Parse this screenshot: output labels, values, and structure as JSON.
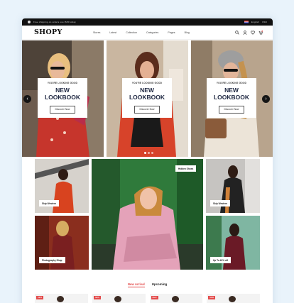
{
  "colors": {
    "accent": "#e34b4b",
    "navy": "#1c2540",
    "page_bg": "#e9f3fb"
  },
  "topbar": {
    "notice": "Free shipping on orders over $50 today",
    "lang": "English",
    "currency": "USD"
  },
  "header": {
    "logo": "SHOPY",
    "nav": [
      "Stores",
      "Latest",
      "Collection",
      "Categories",
      "Pages",
      "Blog"
    ],
    "cart_count": "0",
    "icons": [
      "search-icon",
      "user-icon",
      "heart-icon",
      "cart-icon"
    ]
  },
  "hero": {
    "slides": [
      {
        "kicker": "YOU'RE LOOKING GOOD",
        "title_line1": "NEW",
        "title_line2": "LOOKBOOK",
        "button": "Discover Now"
      },
      {
        "kicker": "YOU'RE LOOKING GOOD",
        "title_line1": "NEW",
        "title_line2": "LOOKBOOK",
        "button": "Discover Now"
      },
      {
        "kicker": "YOU'RE LOOKING GOOD",
        "title_line1": "NEW",
        "title_line2": "LOOKBOOK",
        "button": "Discover Now"
      }
    ],
    "prev": "‹",
    "next": "›"
  },
  "grid": {
    "tags": [
      "Skip Western",
      "Hidden Shoes",
      "Skip Western",
      "Photography Shop",
      "Up To 40% off"
    ]
  },
  "tabs": {
    "items": [
      "New Arrival",
      "Upcoming"
    ],
    "active": "New Arrival"
  },
  "products": {
    "badges": [
      "NEW",
      "NEW",
      "NEW",
      "NEW"
    ]
  }
}
